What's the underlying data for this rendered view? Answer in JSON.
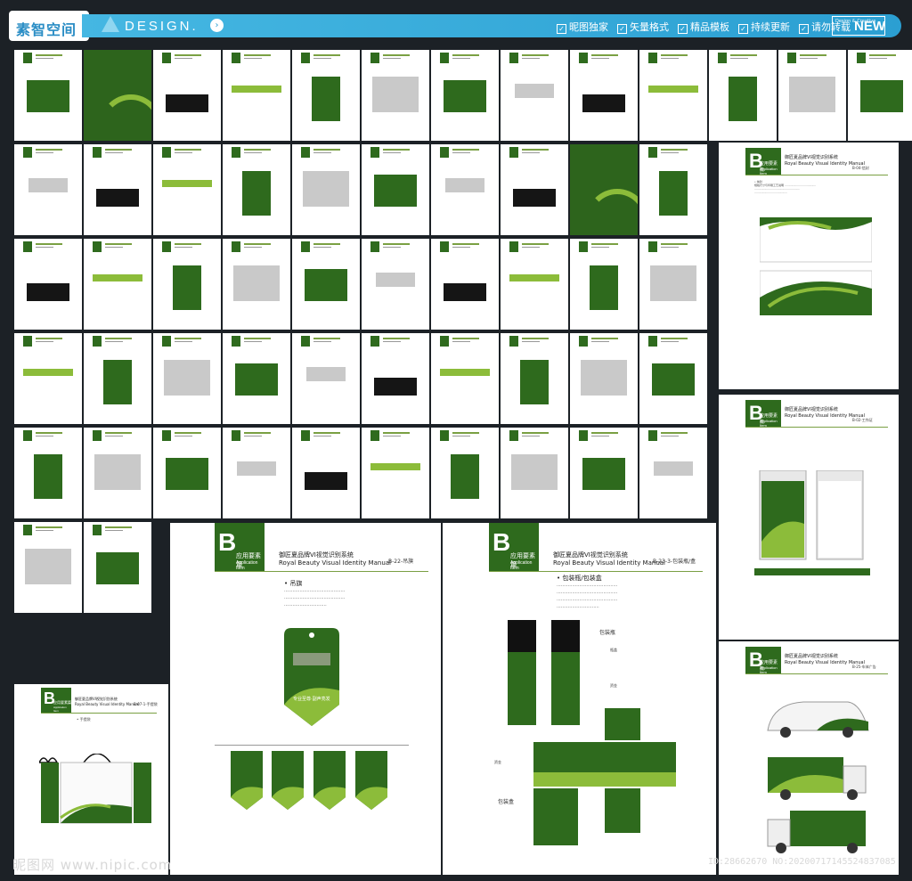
{
  "header": {
    "logo": "素智空间",
    "design": "DESIGN.",
    "arrow": "›",
    "badges": [
      "昵图独家",
      "矢量格式",
      "精品模板",
      "持续更新",
      "请勿转载"
    ],
    "new_small": "Design & Creative",
    "new_big": "NEW"
  },
  "panel_envelope": {
    "letter": "B",
    "section": "应用要素篇",
    "section_en": "Application Item",
    "title": "御匠夏品牌VI视觉识别系统",
    "title_en": "Royal Beauty Visual Identity Manual",
    "code": "B-04-信封"
  },
  "panel_badge": {
    "letter": "B",
    "section": "应用要素篇",
    "section_en": "Application Item",
    "title": "御匠夏品牌VI视觉识别系统",
    "title_en": "Royal Beauty Visual Identity Manual",
    "code": "B-02-工作证"
  },
  "panel_vehicle": {
    "letter": "B",
    "section": "应用要素篇",
    "section_en": "Application Item",
    "title": "御匠夏品牌VI视觉识别系统",
    "title_en": "Royal Beauty Visual Identity Manual",
    "code": "B-25-车体广告"
  },
  "panel_tag": {
    "letter": "B",
    "section": "应用要素篇",
    "section_en": "Application Item",
    "title": "御匠夏品牌VI视觉识别系统",
    "title_en": "Royal Beauty Visual Identity Manual",
    "code": "B-22-吊旗",
    "heading": "• 吊旗",
    "slogan": "专业至尊·副声亮发"
  },
  "panel_package": {
    "letter": "B",
    "section": "应用要素篇",
    "section_en": "Application Item",
    "title": "御匠夏品牌VI视觉识别系统",
    "title_en": "Royal Beauty Visual Identity Manual",
    "code": "B-23-3-包装瓶/盒",
    "heading": "• 包装瓶/包装盒",
    "label_bottle": "包装瓶",
    "label_box": "包装盒",
    "label_cap": "瓶盖",
    "label_body": "资金"
  },
  "panel_bag": {
    "letter": "B",
    "section": "应用要素篇",
    "section_en": "Application Item",
    "title": "御匠夏品牌VI视觉识别系统",
    "title_en": "Royal Beauty Visual Identity Manual",
    "code": "B-07-1-手提袋",
    "heading": "• 手提袋"
  },
  "watermark": {
    "left": "昵图网 www.nipic.com",
    "right": "ID:28662670 NO:20200717145524837085"
  },
  "colors": {
    "dark_green": "#2e6a1d",
    "light_green": "#8cbc3a",
    "blue": "#2b9fd2",
    "background": "#1c2126"
  }
}
